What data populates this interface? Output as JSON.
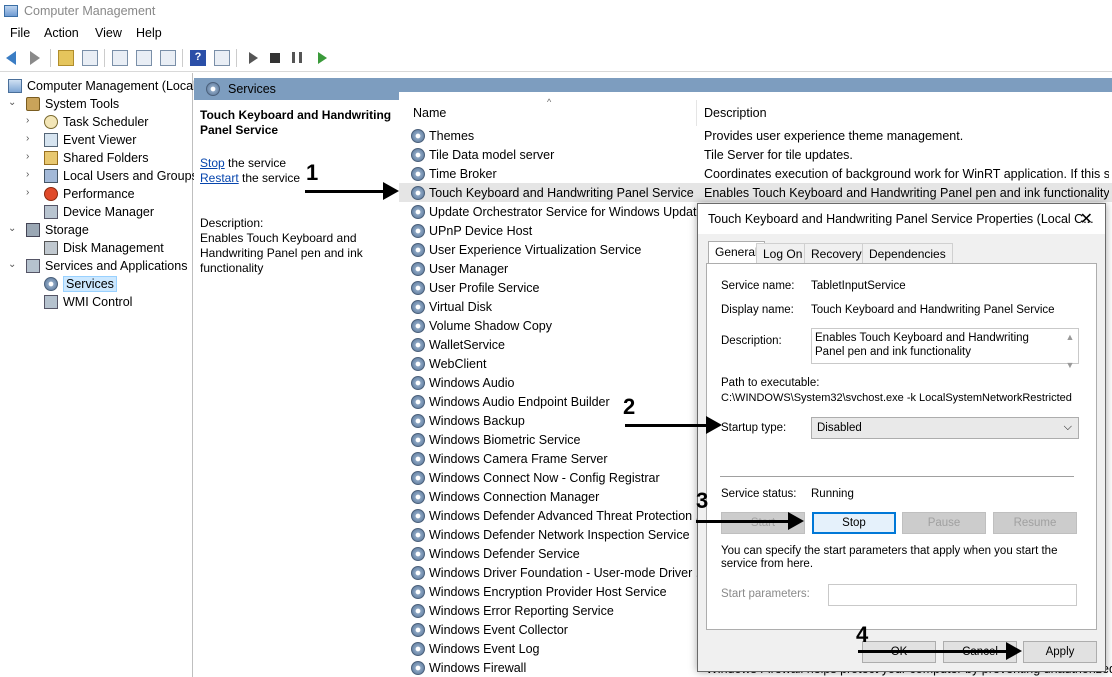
{
  "window": {
    "title": "Computer Management"
  },
  "menu": [
    "File",
    "Action",
    "View",
    "Help"
  ],
  "tree": [
    {
      "label": "Computer Management (Local",
      "level": 0,
      "icon": "computer-icon",
      "exp": ""
    },
    {
      "label": "System Tools",
      "level": 1,
      "icon": "tools-icon",
      "exp": "expanded"
    },
    {
      "label": "Task Scheduler",
      "level": 2,
      "icon": "clock-icon",
      "exp": "collapsed"
    },
    {
      "label": "Event Viewer",
      "level": 2,
      "icon": "event-viewer-icon",
      "exp": "collapsed"
    },
    {
      "label": "Shared Folders",
      "level": 2,
      "icon": "shared-folder-icon",
      "exp": "collapsed"
    },
    {
      "label": "Local Users and Groups",
      "level": 2,
      "icon": "users-icon",
      "exp": "collapsed"
    },
    {
      "label": "Performance",
      "level": 2,
      "icon": "performance-icon",
      "exp": "collapsed"
    },
    {
      "label": "Device Manager",
      "level": 2,
      "icon": "device-manager-icon",
      "exp": ""
    },
    {
      "label": "Storage",
      "level": 1,
      "icon": "storage-icon",
      "exp": "expanded"
    },
    {
      "label": "Disk Management",
      "level": 2,
      "icon": "disk-icon",
      "exp": ""
    },
    {
      "label": "Services and Applications",
      "level": 1,
      "icon": "services-apps-icon",
      "exp": "expanded"
    },
    {
      "label": "Services",
      "level": 2,
      "icon": "gear-icon",
      "exp": "",
      "selected": true
    },
    {
      "label": "WMI Control",
      "level": 2,
      "icon": "wmi-icon",
      "exp": ""
    }
  ],
  "services_header": "Services",
  "extended": {
    "name": "Touch Keyboard and Handwriting Panel Service",
    "stop_link": "Stop",
    "stop_rest": " the service",
    "restart_link": "Restart",
    "restart_rest": " the service",
    "desc_label": "Description:",
    "desc": "Enables Touch Keyboard and Handwriting Panel pen and ink functionality"
  },
  "columns": {
    "name": "Name",
    "description": "Description"
  },
  "rows": [
    {
      "name": "Themes",
      "desc": "Provides user experience theme management."
    },
    {
      "name": "Tile Data model server",
      "desc": "Tile Server for tile updates."
    },
    {
      "name": "Time Broker",
      "desc": "Coordinates execution of background work for WinRT application. If this se..."
    },
    {
      "name": "Touch Keyboard and Handwriting Panel Service",
      "desc": "Enables Touch Keyboard and Handwriting Panel pen and ink functionality",
      "selected": true
    },
    {
      "name": "Update Orchestrator Service for Windows Update",
      "desc": ""
    },
    {
      "name": "UPnP Device Host",
      "desc": ""
    },
    {
      "name": "User Experience Virtualization Service",
      "desc": ""
    },
    {
      "name": "User Manager",
      "desc": ""
    },
    {
      "name": "User Profile Service",
      "desc": ""
    },
    {
      "name": "Virtual Disk",
      "desc": ""
    },
    {
      "name": "Volume Shadow Copy",
      "desc": ""
    },
    {
      "name": "WalletService",
      "desc": ""
    },
    {
      "name": "WebClient",
      "desc": ""
    },
    {
      "name": "Windows Audio",
      "desc": ""
    },
    {
      "name": "Windows Audio Endpoint Builder",
      "desc": ""
    },
    {
      "name": "Windows Backup",
      "desc": ""
    },
    {
      "name": "Windows Biometric Service",
      "desc": ""
    },
    {
      "name": "Windows Camera Frame Server",
      "desc": ""
    },
    {
      "name": "Windows Connect Now - Config Registrar",
      "desc": ""
    },
    {
      "name": "Windows Connection Manager",
      "desc": ""
    },
    {
      "name": "Windows Defender Advanced Threat Protection ...",
      "desc": ""
    },
    {
      "name": "Windows Defender Network Inspection Service",
      "desc": ""
    },
    {
      "name": "Windows Defender Service",
      "desc": ""
    },
    {
      "name": "Windows Driver Foundation - User-mode Driver ...",
      "desc": ""
    },
    {
      "name": "Windows Encryption Provider Host Service",
      "desc": ""
    },
    {
      "name": "Windows Error Reporting Service",
      "desc": ""
    },
    {
      "name": "Windows Event Collector",
      "desc": ""
    },
    {
      "name": "Windows Event Log",
      "desc": ""
    },
    {
      "name": "Windows Firewall",
      "desc": ""
    }
  ],
  "peek": "Windows Firewall helps protect your computer by preventing unauthorized",
  "dialog": {
    "title": "Touch Keyboard and Handwriting Panel Service Properties (Local C...",
    "close": "✕",
    "tabs": [
      "General",
      "Log On",
      "Recovery",
      "Dependencies"
    ],
    "service_name_label": "Service name:",
    "service_name": "TabletInputService",
    "display_name_label": "Display name:",
    "display_name": "Touch Keyboard and Handwriting Panel Service",
    "description_label": "Description:",
    "description": "Enables Touch Keyboard and Handwriting Panel pen and ink functionality",
    "path_label": "Path to executable:",
    "path": "C:\\WINDOWS\\System32\\svchost.exe -k LocalSystemNetworkRestricted",
    "startup_label": "Startup type:",
    "startup_value": "Disabled",
    "status_label": "Service status:",
    "status_value": "Running",
    "btn_start": "Start",
    "btn_stop": "Stop",
    "btn_pause": "Pause",
    "btn_resume": "Resume",
    "hint": "You can specify the start parameters that apply when you start the service from here.",
    "params_label": "Start parameters:",
    "btn_ok": "OK",
    "btn_cancel": "Cancel",
    "btn_apply": "Apply"
  },
  "annotations": [
    "1",
    "2",
    "3",
    "4"
  ]
}
